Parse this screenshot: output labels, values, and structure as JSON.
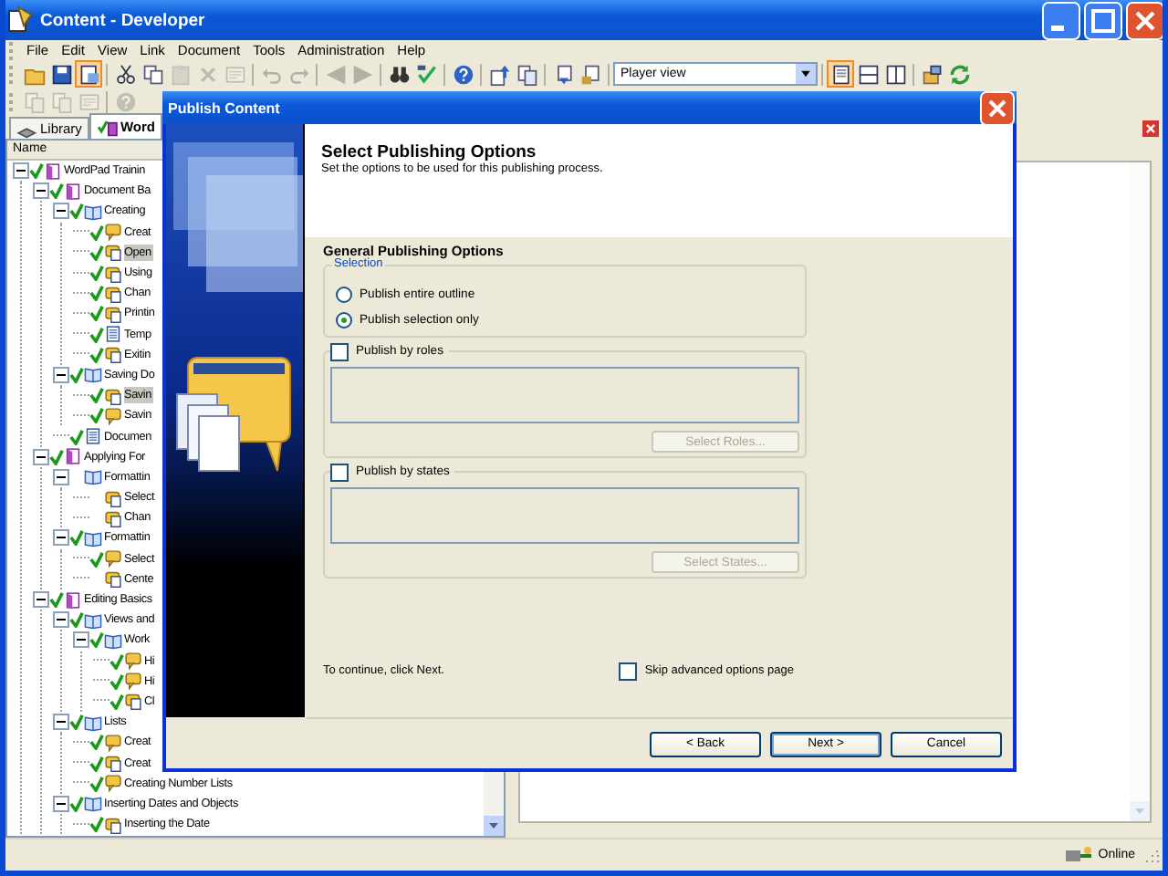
{
  "window": {
    "title": "Content - Developer"
  },
  "menu": [
    "File",
    "Edit",
    "View",
    "Link",
    "Document",
    "Tools",
    "Administration",
    "Help"
  ],
  "toolbar_1": [
    {
      "kind": "open",
      "disabled": false,
      "pressed": false
    },
    {
      "kind": "save",
      "disabled": false,
      "pressed": false
    },
    {
      "kind": "view",
      "disabled": false,
      "pressed": true
    },
    {
      "kind": "sep"
    },
    {
      "kind": "cut",
      "disabled": false,
      "pressed": false
    },
    {
      "kind": "copy",
      "disabled": false,
      "pressed": false
    },
    {
      "kind": "paste",
      "disabled": true,
      "pressed": false
    },
    {
      "kind": "delete",
      "disabled": true,
      "pressed": false
    },
    {
      "kind": "props",
      "disabled": true,
      "pressed": false
    },
    {
      "kind": "sep"
    },
    {
      "kind": "undo",
      "disabled": true,
      "pressed": false
    },
    {
      "kind": "redo",
      "disabled": true,
      "pressed": false
    },
    {
      "kind": "sep"
    },
    {
      "kind": "left",
      "disabled": true,
      "pressed": false
    },
    {
      "kind": "right",
      "disabled": true,
      "pressed": false
    },
    {
      "kind": "sep"
    },
    {
      "kind": "find",
      "disabled": false,
      "pressed": false
    },
    {
      "kind": "spell",
      "disabled": false,
      "pressed": false
    },
    {
      "kind": "sep"
    },
    {
      "kind": "help",
      "disabled": false,
      "pressed": false
    },
    {
      "kind": "sep"
    },
    {
      "kind": "up",
      "disabled": false,
      "pressed": false
    },
    {
      "kind": "copydoc",
      "disabled": false,
      "pressed": false
    },
    {
      "kind": "sep"
    },
    {
      "kind": "import",
      "disabled": false,
      "pressed": false
    },
    {
      "kind": "lock",
      "disabled": false,
      "pressed": false
    },
    {
      "kind": "sep"
    },
    {
      "kind": "combo",
      "value": "Player view"
    },
    {
      "kind": "sep"
    },
    {
      "kind": "layout1",
      "disabled": false,
      "pressed": true
    },
    {
      "kind": "layout2",
      "disabled": false,
      "pressed": false
    },
    {
      "kind": "layout3",
      "disabled": false,
      "pressed": false
    },
    {
      "kind": "sep"
    },
    {
      "kind": "package",
      "disabled": false,
      "pressed": false
    },
    {
      "kind": "refresh",
      "disabled": false,
      "pressed": false
    }
  ],
  "toolbar_2": [
    {
      "kind": "docs",
      "disabled": true,
      "pressed": false
    },
    {
      "kind": "copydoc",
      "disabled": true,
      "pressed": false
    },
    {
      "kind": "props",
      "disabled": true,
      "pressed": false
    },
    {
      "kind": "sep"
    },
    {
      "kind": "help",
      "disabled": true,
      "pressed": false
    }
  ],
  "tabs": [
    {
      "label": "Library",
      "kind": "library",
      "selected": false
    },
    {
      "label": "Word",
      "kind": "document",
      "selected": true
    }
  ],
  "tree": {
    "header": "Name",
    "items": [
      {
        "label": "WordPad Trainin",
        "kind": "book",
        "checked": true,
        "expanded": true,
        "selected": false,
        "children": [
          {
            "label": "Document Ba",
            "kind": "book",
            "checked": true,
            "expanded": true,
            "selected": false,
            "children": [
              {
                "label": "Creating",
                "kind": "section",
                "checked": true,
                "expanded": true,
                "selected": false,
                "children": [
                  {
                    "label": "Creat",
                    "kind": "question",
                    "checked": true,
                    "selected": false
                  },
                  {
                    "label": "Open",
                    "kind": "topic",
                    "checked": true,
                    "selected": true
                  },
                  {
                    "label": "Using",
                    "kind": "topic",
                    "checked": true,
                    "selected": false
                  },
                  {
                    "label": "Chan",
                    "kind": "topic",
                    "checked": true,
                    "selected": false
                  },
                  {
                    "label": "Printin",
                    "kind": "topic",
                    "checked": true,
                    "selected": false
                  },
                  {
                    "label": "Temp",
                    "kind": "doc",
                    "checked": true,
                    "selected": false
                  },
                  {
                    "label": "Exitin",
                    "kind": "topic",
                    "checked": true,
                    "selected": false
                  }
                ]
              },
              {
                "label": "Saving Do",
                "kind": "section",
                "checked": true,
                "expanded": true,
                "selected": false,
                "children": [
                  {
                    "label": "Savin",
                    "kind": "topic",
                    "checked": true,
                    "selected": true
                  },
                  {
                    "label": "Savin",
                    "kind": "question",
                    "checked": true,
                    "selected": false
                  }
                ]
              },
              {
                "label": "Documen",
                "kind": "doc",
                "checked": true,
                "selected": false
              }
            ]
          },
          {
            "label": "Applying For",
            "kind": "book",
            "checked": true,
            "expanded": true,
            "selected": false,
            "children": [
              {
                "label": "Formattin",
                "kind": "section",
                "checked": false,
                "expanded": true,
                "selected": false,
                "children": [
                  {
                    "label": "Select",
                    "kind": "topic",
                    "checked": false,
                    "selected": false
                  },
                  {
                    "label": "Chan",
                    "kind": "topic",
                    "checked": false,
                    "selected": false
                  }
                ]
              },
              {
                "label": "Formattin",
                "kind": "section",
                "checked": true,
                "expanded": true,
                "selected": false,
                "children": [
                  {
                    "label": "Select",
                    "kind": "question",
                    "checked": true,
                    "selected": false
                  },
                  {
                    "label": "Cente",
                    "kind": "topic",
                    "checked": false,
                    "selected": false
                  }
                ]
              }
            ]
          },
          {
            "label": "Editing Basics",
            "kind": "book",
            "checked": true,
            "expanded": true,
            "selected": false,
            "children": [
              {
                "label": "Views and",
                "kind": "section",
                "checked": true,
                "expanded": true,
                "selected": false,
                "children": [
                  {
                    "label": "Work",
                    "kind": "section",
                    "checked": true,
                    "expanded": true,
                    "selected": false,
                    "children": [
                      {
                        "label": "Hi",
                        "kind": "question",
                        "checked": true,
                        "selected": false
                      },
                      {
                        "label": "Hi",
                        "kind": "question",
                        "checked": true,
                        "selected": false
                      },
                      {
                        "label": "Cl",
                        "kind": "topic",
                        "checked": true,
                        "selected": false
                      }
                    ]
                  }
                ]
              },
              {
                "label": "Lists",
                "kind": "section",
                "checked": true,
                "expanded": true,
                "selected": false,
                "children": [
                  {
                    "label": "Creat",
                    "kind": "question",
                    "checked": true,
                    "selected": false
                  },
                  {
                    "label": "Creat",
                    "kind": "topic",
                    "checked": true,
                    "selected": false
                  },
                  {
                    "label": "Creating Number Lists",
                    "kind": "question",
                    "checked": true,
                    "selected": false
                  }
                ]
              },
              {
                "label": "Inserting Dates and Objects",
                "kind": "section",
                "checked": true,
                "expanded": true,
                "selected": false,
                "children": [
                  {
                    "label": "Inserting the Date",
                    "kind": "topic",
                    "checked": true,
                    "selected": false
                  }
                ]
              }
            ]
          }
        ]
      }
    ]
  },
  "status_bar": {
    "status": "Online"
  },
  "dialog": {
    "title": "Publish Content",
    "heading": "Select Publishing Options",
    "subheading": "Set the options to be used for this publishing process.",
    "section_title": "General Publishing Options",
    "selection": {
      "legend": "Selection",
      "options": [
        {
          "label": "Publish entire outline",
          "selected": false
        },
        {
          "label": "Publish selection only",
          "selected": true
        }
      ]
    },
    "groups": [
      {
        "label": "Publish by roles",
        "checked": false,
        "button": "Select Roles...",
        "button_disabled": true
      },
      {
        "label": "Publish by states",
        "checked": false,
        "button": "Select States...",
        "button_disabled": true
      }
    ],
    "hint": "To continue, click Next.",
    "skip_option": {
      "label": "Skip advanced options page",
      "checked": false
    },
    "buttons": [
      {
        "label": "< Back",
        "default": false
      },
      {
        "label": "Next >",
        "default": true
      },
      {
        "label": "Cancel",
        "default": false
      }
    ]
  }
}
